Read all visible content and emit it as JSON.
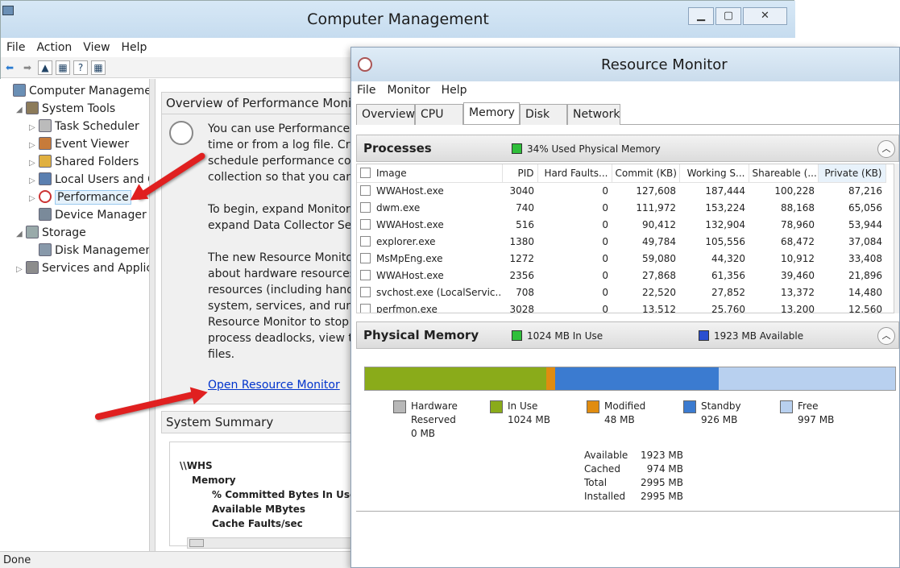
{
  "cm": {
    "title": "Computer Management",
    "menu": [
      "File",
      "Action",
      "View",
      "Help"
    ],
    "tree": [
      {
        "label": "Computer Management",
        "indent": 0,
        "arrow": "",
        "icon": "computer-icon",
        "color": "#6a8fb5"
      },
      {
        "label": "System Tools",
        "indent": 1,
        "arrow": "◢",
        "icon": "tools-icon",
        "color": "#8c7b5a"
      },
      {
        "label": "Task Scheduler",
        "indent": 2,
        "arrow": "▷",
        "icon": "clock-icon",
        "color": "#bbbbbb"
      },
      {
        "label": "Event Viewer",
        "indent": 2,
        "arrow": "▷",
        "icon": "event-viewer-icon",
        "color": "#c77b3a"
      },
      {
        "label": "Shared Folders",
        "indent": 2,
        "arrow": "▷",
        "icon": "folder-icon",
        "color": "#e0b040"
      },
      {
        "label": "Local Users and Gro",
        "indent": 2,
        "arrow": "▷",
        "icon": "users-icon",
        "color": "#5a7fb0"
      },
      {
        "label": "Performance",
        "indent": 2,
        "arrow": "▷",
        "icon": "performance-icon",
        "color": "#ffffff",
        "selected": true
      },
      {
        "label": "Device Manager",
        "indent": 2,
        "arrow": "",
        "icon": "device-manager-icon",
        "color": "#7a8a9a"
      },
      {
        "label": "Storage",
        "indent": 1,
        "arrow": "◢",
        "icon": "storage-icon",
        "color": "#9aa"
      },
      {
        "label": "Disk Management",
        "indent": 2,
        "arrow": "",
        "icon": "disk-icon",
        "color": "#8899aa"
      },
      {
        "label": "Services and Applicat",
        "indent": 1,
        "arrow": "▷",
        "icon": "services-icon",
        "color": "#8c8c8c"
      }
    ],
    "overview_title": "Overview of Performance Monitor",
    "overview_lines": [
      "You can use Performance Mo",
      "time or from a log file. Crea",
      "schedule performance coun",
      "collection so that you can a",
      "",
      "To begin, expand Monitorin",
      "expand Data Collector Sets",
      "",
      "The new Resource Monitor",
      "about hardware resources",
      "resources (including handle",
      "system, services, and runnin",
      "Resource Monitor to stop p",
      "process deadlocks, view th",
      "files."
    ],
    "open_link": "Open Resource Monitor",
    "summary_title": "System Summary",
    "summary": [
      "\\\\WHS",
      "Memory",
      "% Committed Bytes In Use",
      "Available MBytes",
      "Cache Faults/sec"
    ],
    "status": "Done"
  },
  "rm": {
    "title": "Resource Monitor",
    "menu": [
      "File",
      "Monitor",
      "Help"
    ],
    "tabs": [
      "Overview",
      "CPU",
      "Memory",
      "Disk",
      "Network"
    ],
    "active_tab": "Memory",
    "processes_title": "Processes",
    "processes_info": "34% Used Physical Memory",
    "columns": [
      "Image",
      "PID",
      "Hard Faults...",
      "Commit (KB)",
      "Working S...",
      "Shareable (...",
      "Private (KB)"
    ],
    "rows": [
      [
        "WWAHost.exe",
        "3040",
        "0",
        "127,608",
        "187,444",
        "100,228",
        "87,216"
      ],
      [
        "dwm.exe",
        "740",
        "0",
        "111,972",
        "153,224",
        "88,168",
        "65,056"
      ],
      [
        "WWAHost.exe",
        "516",
        "0",
        "90,412",
        "132,904",
        "78,960",
        "53,944"
      ],
      [
        "explorer.exe",
        "1380",
        "0",
        "49,784",
        "105,556",
        "68,472",
        "37,084"
      ],
      [
        "MsMpEng.exe",
        "1272",
        "0",
        "59,080",
        "44,320",
        "10,912",
        "33,408"
      ],
      [
        "WWAHost.exe",
        "2356",
        "0",
        "27,868",
        "61,356",
        "39,460",
        "21,896"
      ],
      [
        "svchost.exe (LocalServic...",
        "708",
        "0",
        "22,520",
        "27,852",
        "13,372",
        "14,480"
      ],
      [
        "perfmon.exe",
        "3028",
        "0",
        "13,512",
        "25,760",
        "13,200",
        "12,560"
      ]
    ],
    "physical_title": "Physical Memory",
    "in_use_info": "1024 MB In Use",
    "available_info": "1923 MB Available",
    "bar": [
      {
        "name": "in-use",
        "fraction": 0.342,
        "color": "#8aab1a"
      },
      {
        "name": "modified",
        "fraction": 0.016,
        "color": "#e08c10"
      },
      {
        "name": "standby",
        "fraction": 0.309,
        "color": "#3b7bd0"
      },
      {
        "name": "free",
        "fraction": 0.333,
        "color": "#b8d0ef"
      }
    ],
    "legend": [
      {
        "label": "Hardware",
        "label2": "Reserved",
        "value": "0 MB",
        "color": "#b8b8b8"
      },
      {
        "label": "In Use",
        "label2": "",
        "value": "1024 MB",
        "color": "#8aab1a"
      },
      {
        "label": "Modified",
        "label2": "",
        "value": "48 MB",
        "color": "#e08c10"
      },
      {
        "label": "Standby",
        "label2": "",
        "value": "926 MB",
        "color": "#3b7bd0"
      },
      {
        "label": "Free",
        "label2": "",
        "value": "997 MB",
        "color": "#b8d0ef"
      }
    ],
    "stats": [
      [
        "Available",
        "1923 MB"
      ],
      [
        "Cached",
        "974 MB"
      ],
      [
        "Total",
        "2995 MB"
      ],
      [
        "Installed",
        "2995 MB"
      ]
    ]
  }
}
